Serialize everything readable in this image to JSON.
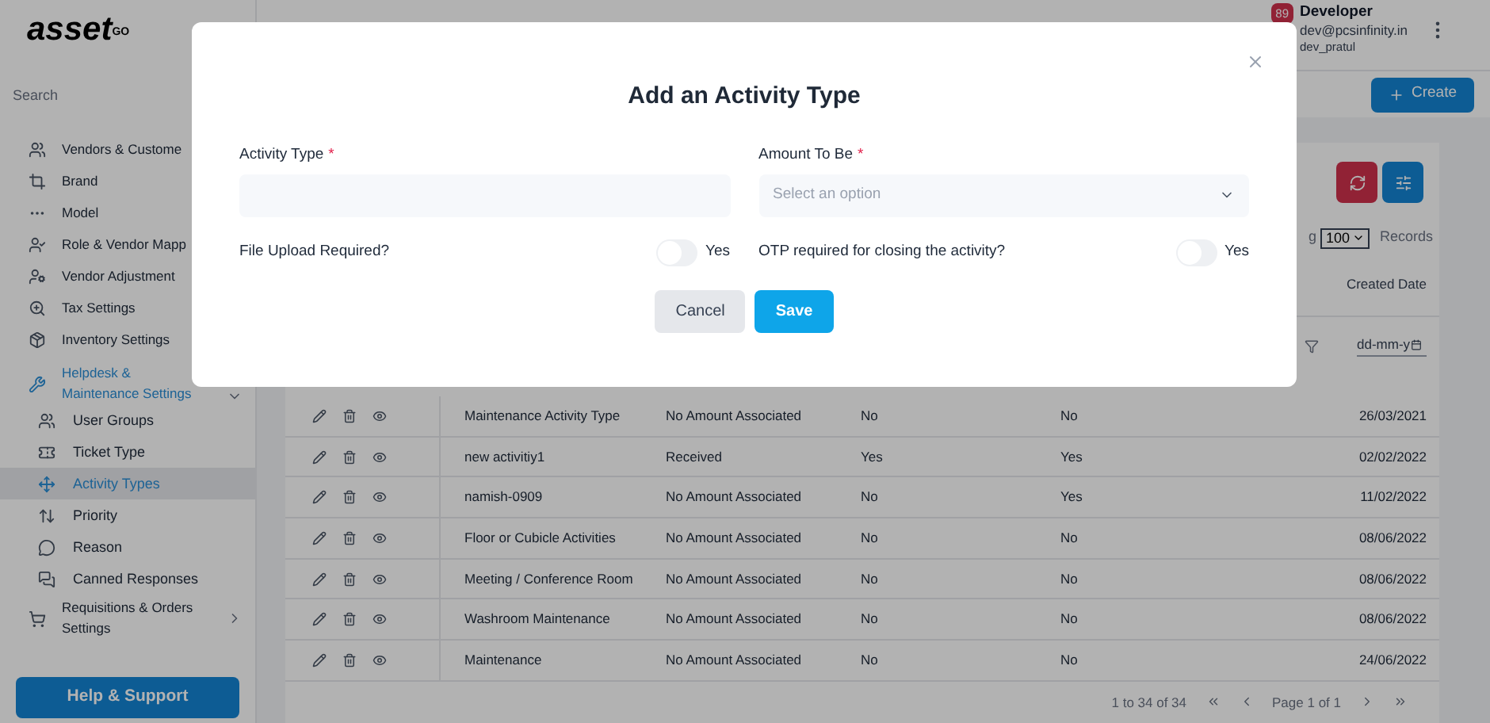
{
  "logo": {
    "text": "asset",
    "superscript": "GO"
  },
  "sidebar": {
    "search_placeholder": "Search",
    "items": [
      {
        "label": "Vendors & Custome",
        "selected": false
      },
      {
        "label": "Brand",
        "selected": false
      },
      {
        "label": "Model",
        "selected": false
      },
      {
        "label": "Role & Vendor Mapp",
        "selected": false
      },
      {
        "label": "Vendor Adjustment",
        "selected": false
      },
      {
        "label": "Tax Settings",
        "selected": false
      },
      {
        "label": "Inventory Settings",
        "selected": false
      },
      {
        "label": "Helpdesk & Maintenance Settings",
        "selected": true,
        "expanded": true,
        "children": [
          {
            "label": "User Groups",
            "selected": false
          },
          {
            "label": "Ticket Type",
            "selected": false
          },
          {
            "label": "Activity Types",
            "selected": true
          },
          {
            "label": "Priority",
            "selected": false
          },
          {
            "label": "Reason",
            "selected": false
          },
          {
            "label": "Canned Responses",
            "selected": false
          }
        ]
      },
      {
        "label": "Requisitions & Orders Settings",
        "selected": false,
        "expanded": false
      }
    ],
    "help_button": "Help & Support"
  },
  "header": {
    "notifications": "89",
    "user_name": "Developer",
    "email": "dev@pcsinfinity.in",
    "username": "dev_pratul"
  },
  "create_button": "Create",
  "table": {
    "showing_fragment": "g",
    "page_size": "100",
    "records_label": "Records",
    "visible_column": "Created Date",
    "date_filter": "dd-mm-y",
    "rows": [
      [
        "Maintenance Activity Type",
        "No Amount Associated",
        "No",
        "No",
        "26/03/2021"
      ],
      [
        "new activitiy1",
        "Received",
        "Yes",
        "Yes",
        "02/02/2022"
      ],
      [
        "namish-0909",
        "No Amount Associated",
        "No",
        "Yes",
        "11/02/2022"
      ],
      [
        "Floor or Cubicle Activities",
        "No Amount Associated",
        "No",
        "No",
        "08/06/2022"
      ],
      [
        "Meeting / Conference Room",
        "No Amount Associated",
        "No",
        "No",
        "08/06/2022"
      ],
      [
        "Washroom Maintenance",
        "No Amount Associated",
        "No",
        "No",
        "08/06/2022"
      ],
      [
        "Maintenance",
        "No Amount Associated",
        "No",
        "No",
        "24/06/2022"
      ]
    ],
    "pagination": {
      "range": "1 to 34 of 34",
      "page": "Page 1 of 1"
    }
  },
  "modal": {
    "title": "Add an Activity Type",
    "activity_type": {
      "label": "Activity Type",
      "required_mark": "*"
    },
    "amount": {
      "label": "Amount To Be",
      "required_mark": "*",
      "placeholder": "Select an option"
    },
    "toggles": [
      {
        "label": "File Upload Required?",
        "on": false,
        "text": "Yes"
      },
      {
        "label": "OTP required for closing the activity?",
        "on": false,
        "text": "Yes"
      }
    ],
    "buttons": [
      {
        "label": "Cancel",
        "kind": "secondary"
      },
      {
        "label": "Save",
        "kind": "primary"
      }
    ]
  }
}
